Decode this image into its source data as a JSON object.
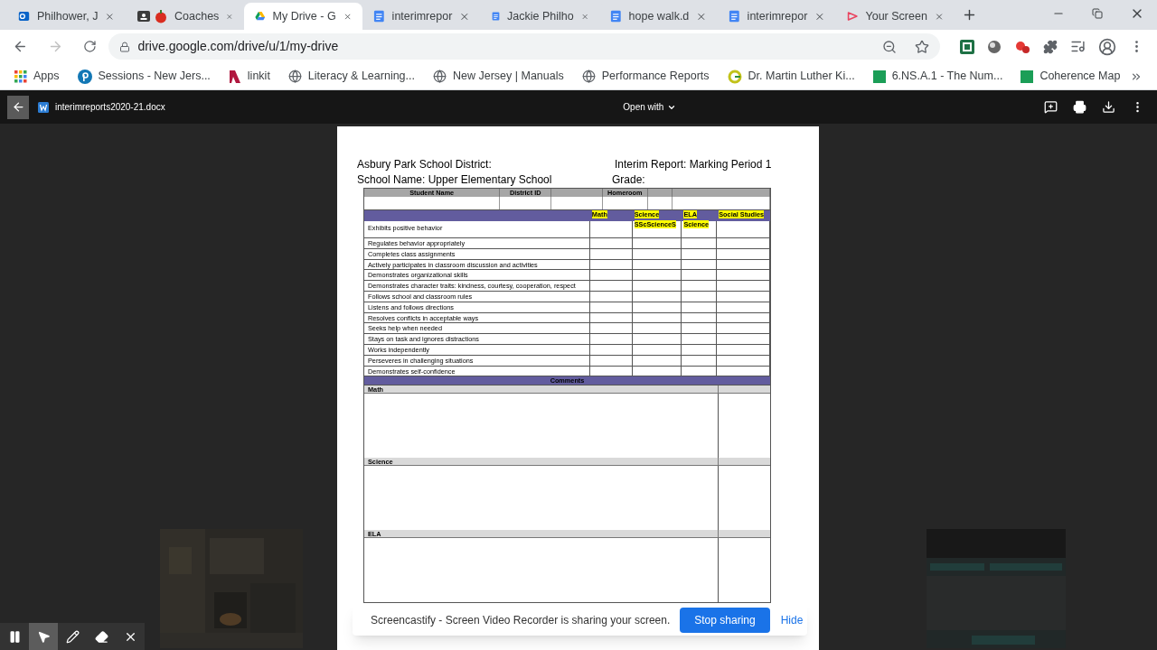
{
  "browser": {
    "tabs": [
      {
        "title": "Philhower, J",
        "kind": "outlook",
        "selected": false
      },
      {
        "title": "Coaches",
        "kind": "coaches",
        "selected": false
      },
      {
        "title": "My Drive - G",
        "kind": "drive",
        "selected": true
      },
      {
        "title": "interimrepor",
        "kind": "docs",
        "selected": false
      },
      {
        "title": "Jackie Philho",
        "kind": "docs",
        "selected": false
      },
      {
        "title": "hope walk.d",
        "kind": "docs",
        "selected": false
      },
      {
        "title": "interimrepor",
        "kind": "docs",
        "selected": false
      },
      {
        "title": "Your Screen",
        "kind": "screencastify",
        "selected": false
      }
    ],
    "address": "drive.google.com/drive/u/1/my-drive",
    "bookmarks": [
      {
        "label": "Apps",
        "kind": "apps"
      },
      {
        "label": "Sessions - New Jers...",
        "kind": "pin"
      },
      {
        "label": "linkit",
        "kind": "ribbon"
      },
      {
        "label": "Literacy & Learning...",
        "kind": "globe"
      },
      {
        "label": "New Jersey | Manuals",
        "kind": "globe"
      },
      {
        "label": "Performance Reports",
        "kind": "globe"
      },
      {
        "label": "Dr. Martin Luther Ki...",
        "kind": "ring"
      },
      {
        "label": "6.NS.A.1 - The Num...",
        "kind": "sheet"
      },
      {
        "label": "Coherence Map",
        "kind": "sheet"
      }
    ]
  },
  "viewer": {
    "file_name": "interimreports2020-21.docx",
    "open_with": "Open with"
  },
  "document": {
    "header_left": [
      "Asbury Park School District:",
      "School Name: Upper Elementary School"
    ],
    "header_right": [
      "Interim Report: Marking Period 1",
      "Grade:"
    ],
    "student_columns": [
      "Student Name",
      "District ID",
      "Homeroom"
    ],
    "subjects": [
      {
        "lines": [
          "Math"
        ]
      },
      {
        "lines": [
          "Science",
          "SScScienceS"
        ]
      },
      {
        "lines": [
          "ELA",
          "Science"
        ]
      },
      {
        "lines": [
          "Social Studies"
        ]
      }
    ],
    "behaviors": [
      "Exhibits positive behavior",
      "Regulates behavior appropriately",
      "Completes class assignments",
      "Actively participates in classroom discussion and activities",
      "Demonstrates organizational skills",
      "Demonstrates character traits: kindness, courtesy, cooperation, respect",
      "Follows school and classroom rules",
      "Listens and follows directions",
      "Resolves conflicts in acceptable ways",
      "Seeks help when needed",
      "Stays on task and ignores distractions",
      "Works independently",
      "Perseveres in challenging situations",
      "Demonstrates self-confidence"
    ],
    "comments_title": "Comments",
    "comment_sections": [
      "Math",
      "Science",
      "ELA"
    ]
  },
  "share_bar": {
    "message": "Screencastify - Screen Video Recorder is sharing your screen.",
    "stop": "Stop sharing",
    "hide": "Hide"
  },
  "annotation_tools": [
    {
      "kind": "pause",
      "selected": false
    },
    {
      "kind": "cursor",
      "selected": true
    },
    {
      "kind": "pen",
      "selected": false
    },
    {
      "kind": "eraser",
      "selected": false
    },
    {
      "kind": "close",
      "selected": false
    }
  ]
}
